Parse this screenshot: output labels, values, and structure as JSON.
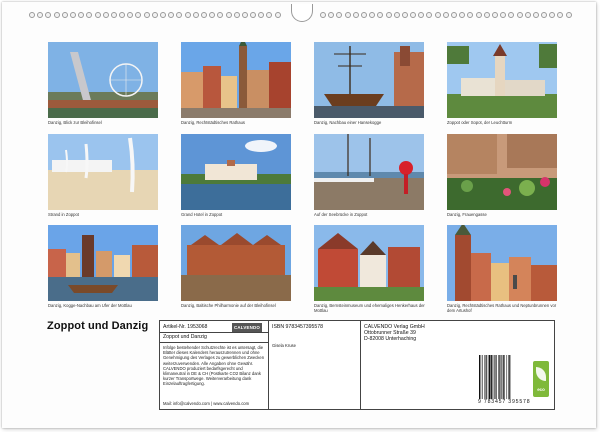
{
  "calendar": {
    "title": "Zoppot und Danzig"
  },
  "photos": [
    {
      "caption": "Danzig, Blick zur Bleihofinsel",
      "scene": "ferris-wheel"
    },
    {
      "caption": "Danzig, Rechtstädtisches Rathaus",
      "scene": "old-town"
    },
    {
      "caption": "Danzig, Nachbau einer Hansekogge",
      "scene": "ship"
    },
    {
      "caption": "Zoppot oder Sopot, der Leuchtturm",
      "scene": "lighthouse"
    },
    {
      "caption": "Strand in Zoppot",
      "scene": "beach"
    },
    {
      "caption": "Grand Hotel in Zoppot",
      "scene": "hotel"
    },
    {
      "caption": "Auf der Seebrücke in Zoppot",
      "scene": "pier"
    },
    {
      "caption": "Danzig, Frauengasse",
      "scene": "flowers"
    },
    {
      "caption": "Danzig, Kogge-Nachbau am Ufer der Mottlau",
      "scene": "riverside"
    },
    {
      "caption": "Danzig, Baltische Philharmonie auf der Bleihofinsel",
      "scene": "philharmonic"
    },
    {
      "caption": "Danzig, Bernsteinmuseum und ehemaliges Henkerhaus der Mottlau",
      "scene": "museum"
    },
    {
      "caption": "Danzig, Rechtstädtisches Rathaus und Neptunbrunnen vor dem Artushof",
      "scene": "neptune"
    }
  ],
  "info": {
    "article_no": "Artikel-Nr. 1953068",
    "brand": "CALVENDO",
    "product_title": "Zoppot und Danzig",
    "legal_text": "Infolge bestehender Schutzrechte ist es untersagt, die Blätter dieses Kalenders herauszutrennen und ohne Genehmigung des Verlages zu gewerblichen Zwecken weiterzuverwenden. Alle Angaben ohne Gewähr. CALVENDO produziert bedarfsgerecht und klimaneutral in DE & CH (Postkarte CO2 Bilanz dank kurzer Transportwege. Weiterverarbeitung dank Einzelauftragfertigung.",
    "contact": "Mail: info@calvendo.com | www.calvendo.com",
    "isbn": "ISBN 9783457395578",
    "author": "Gisela Kruse",
    "publisher_name": "CALVENDO Verlag GmbH",
    "publisher_street": "Ottobrunner Straße 39",
    "publisher_city": "D-82008 Unterhaching",
    "barcode_number": "9 783457 395578",
    "eco_label": "eco"
  }
}
